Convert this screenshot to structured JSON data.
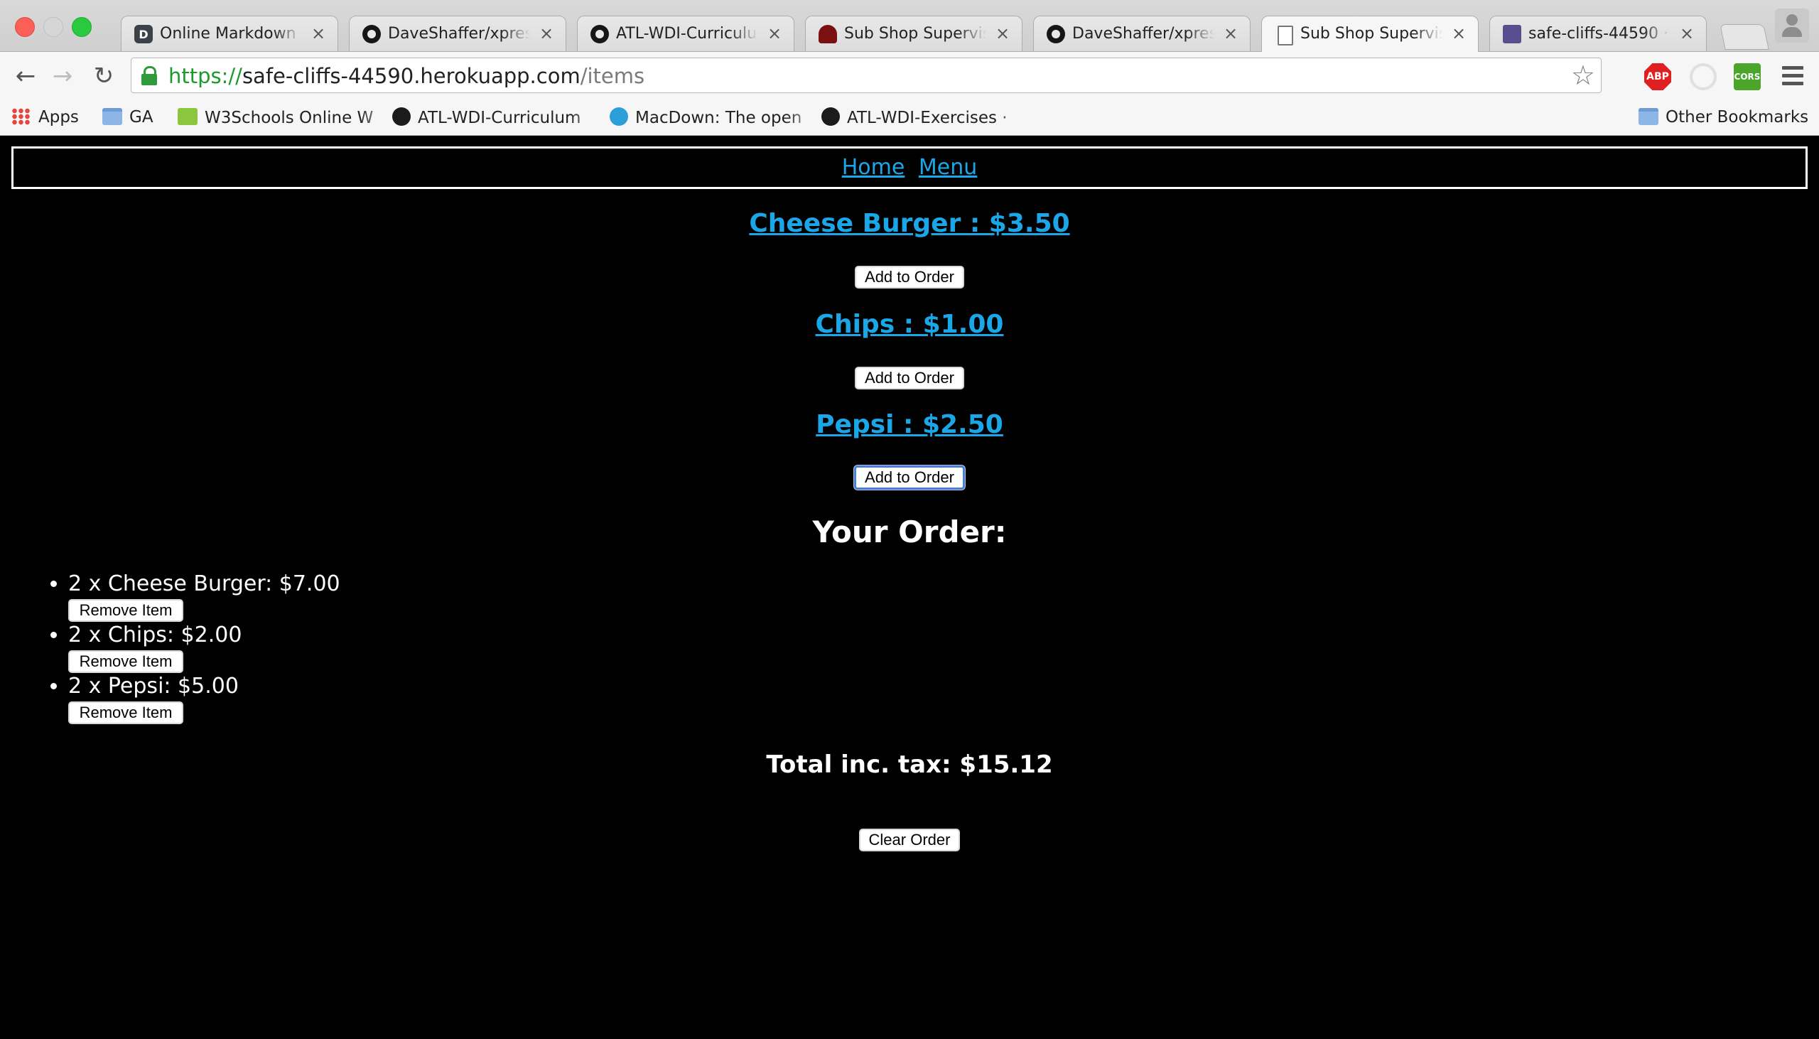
{
  "browser": {
    "tabs": [
      {
        "title": "Online Markdown Ed",
        "favicon": "dillinger-icon",
        "active": false
      },
      {
        "title": "DaveShaffer/xpress-",
        "favicon": "github-icon",
        "active": false
      },
      {
        "title": "ATL-WDI-Curriculum",
        "favicon": "github-icon",
        "active": false
      },
      {
        "title": "Sub Shop Supervisor",
        "favicon": "sub-shop-icon",
        "active": false
      },
      {
        "title": "DaveShaffer/xpress-",
        "favicon": "github-icon",
        "active": false
      },
      {
        "title": "Sub Shop Supervisor",
        "favicon": "page-icon",
        "active": true
      },
      {
        "title": "safe-cliffs-44590 · L",
        "favicon": "heroku-icon",
        "active": false
      }
    ],
    "tab_close": "×",
    "url_scheme": "https://",
    "url_host": "safe-cliffs-44590.herokuapp.com",
    "url_path": "/items",
    "extensions": {
      "abp": "ABP",
      "cors": "CORS"
    },
    "bookmarks": [
      {
        "label": "Apps",
        "icon": "apps-icon"
      },
      {
        "label": "GA",
        "icon": "folder-icon"
      },
      {
        "label": "W3Schools Online W",
        "icon": "w3schools-icon"
      },
      {
        "label": "ATL-WDI-Curriculum",
        "icon": "github-icon"
      },
      {
        "label": "MacDown: The open",
        "icon": "macdown-icon"
      },
      {
        "label": "ATL-WDI-Exercises ·",
        "icon": "github-icon"
      }
    ],
    "other_bookmarks": "Other Bookmarks"
  },
  "site": {
    "nav": {
      "home": "Home",
      "menu": "Menu"
    },
    "items": [
      {
        "label": "Cheese Burger : $3.50",
        "button": "Add to Order"
      },
      {
        "label": "Chips : $1.00",
        "button": "Add to Order"
      },
      {
        "label": "Pepsi : $2.50",
        "button": "Add to Order"
      }
    ],
    "order_title": "Your Order:",
    "order_items": [
      {
        "text": "2 x Cheese Burger: $7.00",
        "button": "Remove Item"
      },
      {
        "text": "2 x Chips: $2.00",
        "button": "Remove Item"
      },
      {
        "text": "2 x Pepsi: $5.00",
        "button": "Remove Item"
      }
    ],
    "total": "Total inc. tax: $15.12",
    "clear_button": "Clear Order"
  },
  "colors": {
    "link": "#1ba6e8",
    "page_background": "#000000",
    "url_scheme": "#1a9b2b"
  }
}
